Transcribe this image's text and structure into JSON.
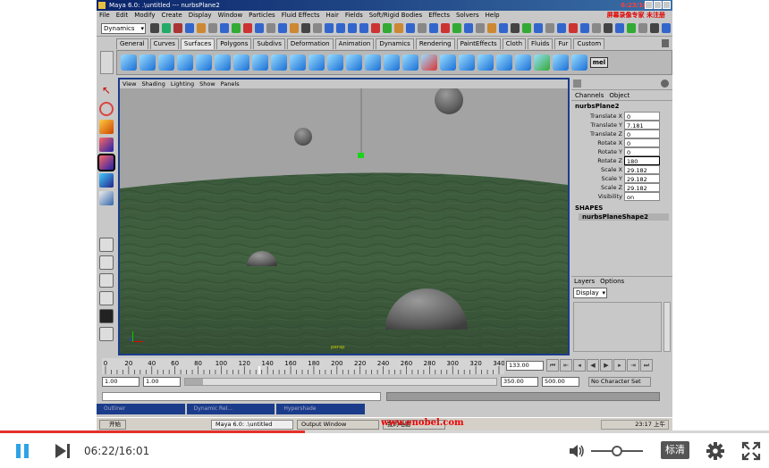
{
  "maya": {
    "title": "Maya 6.0: .\\untitled  ---  nurbsPlane2",
    "clock": "6:23/16",
    "menu": [
      "File",
      "Edit",
      "Modify",
      "Create",
      "Display",
      "Window",
      "Particles",
      "Fluid Effects",
      "Hair",
      "Fields",
      "Soft/Rigid Bodies",
      "Effects",
      "Solvers",
      "Help"
    ],
    "promo": "屏幕录像专家 未注册",
    "mode": "Dynamics",
    "shelf_tabs": [
      "General",
      "Curves",
      "Surfaces",
      "Polygons",
      "Subdivs",
      "Deformation",
      "Animation",
      "Dynamics",
      "Rendering",
      "PaintEffects",
      "Cloth",
      "Fluids",
      "Fur",
      "Custom"
    ],
    "active_shelf_tab": "Surfaces",
    "shelf_mel": "mel",
    "viewport_menu": [
      "View",
      "Shading",
      "Lighting",
      "Show",
      "Panels"
    ],
    "viewport_label": "persp",
    "channel_tabs": [
      "Channels",
      "Object"
    ],
    "object_name": "nurbsPlane2",
    "attributes": [
      {
        "name": "Translate X",
        "value": "0"
      },
      {
        "name": "Translate Y",
        "value": "7.181"
      },
      {
        "name": "Translate Z",
        "value": "0"
      },
      {
        "name": "Rotate X",
        "value": "0"
      },
      {
        "name": "Rotate Y",
        "value": "0"
      },
      {
        "name": "Rotate Z",
        "value": "180"
      },
      {
        "name": "Scale X",
        "value": "29.182"
      },
      {
        "name": "Scale Y",
        "value": "29.182"
      },
      {
        "name": "Scale Z",
        "value": "29.182"
      },
      {
        "name": "Visibility",
        "value": "on"
      }
    ],
    "shapes_label": "SHAPES",
    "shape_name": "nurbsPlaneShape2",
    "layers_menu": [
      "Layers",
      "Options"
    ],
    "layers_mode": "Display",
    "timeline_ticks": [
      "0",
      "20",
      "40",
      "60",
      "80",
      "100",
      "120",
      "140",
      "160",
      "180",
      "200",
      "220",
      "240",
      "260",
      "280",
      "300",
      "320",
      "340"
    ],
    "current_frame": "133.00",
    "range_start": "1.00",
    "range_start2": "1.00",
    "range_end": "350.00",
    "range_end2": "500.00",
    "character_set": "No Character Set",
    "panels": [
      "Outliner",
      "Dynamic Rel...",
      "Hypershade"
    ],
    "taskbar": {
      "start": "开始",
      "items": [
        "Maya 6.0: .\\untitled",
        "Output Window",
        "我的电脑"
      ],
      "tray_time": "23:17 上午"
    },
    "watermark": "www.enobel.com"
  },
  "player": {
    "current_time": "06:22",
    "total_time": "16:01",
    "time_display": "06:22/16:01",
    "progress": 0.397,
    "volume": 0.5,
    "quality": "标清",
    "accent_color": "#2ea3e6",
    "progress_color": "#e4312c"
  }
}
